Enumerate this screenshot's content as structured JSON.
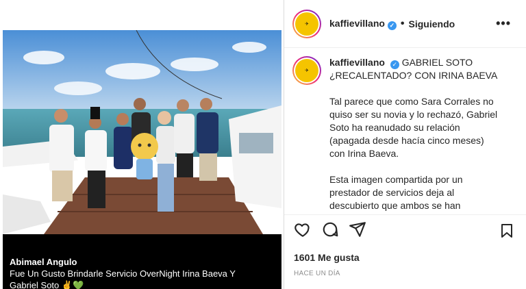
{
  "post": {
    "caption_name": "Abimael Angulo",
    "caption_line1": "Fue Un Gusto Brindarle Servicio OverNight Irina Baeva Y",
    "caption_line2": "Gabriel Soto",
    "caption_emoji": "✌💚"
  },
  "header": {
    "username": "kaffievillano",
    "separator": "•",
    "follow_label": "Siguiendo",
    "more_label": "•••"
  },
  "comment": {
    "username": "kaffievillano",
    "title": "GABRIEL SOTO ¿RECALENTADO? CON IRINA BAEVA",
    "paragraph1": "Tal parece que como Sara Corrales no quiso ser su novia y lo rechazó, Gabriel Soto ha reanudado su relación (apagada desde hacía cinco meses) con Irina Baeva.",
    "paragraph2": "Esta imagen compartida por un prestador de servicios deja al descubierto que ambos se han"
  },
  "footer": {
    "likes": "1601 Me gusta",
    "time_ago": "HACE UN DÍA"
  },
  "icons": {
    "like": "heart-icon",
    "comment": "comment-icon",
    "share": "share-icon",
    "save": "bookmark-icon",
    "verified": "verified-icon"
  },
  "colors": {
    "verified": "#3897f0",
    "avatar_ring_start": "#f9ce34",
    "avatar_ring_end": "#6228d7",
    "avatar_fill": "#f5c400",
    "muted_text": "#8e8e8e"
  }
}
